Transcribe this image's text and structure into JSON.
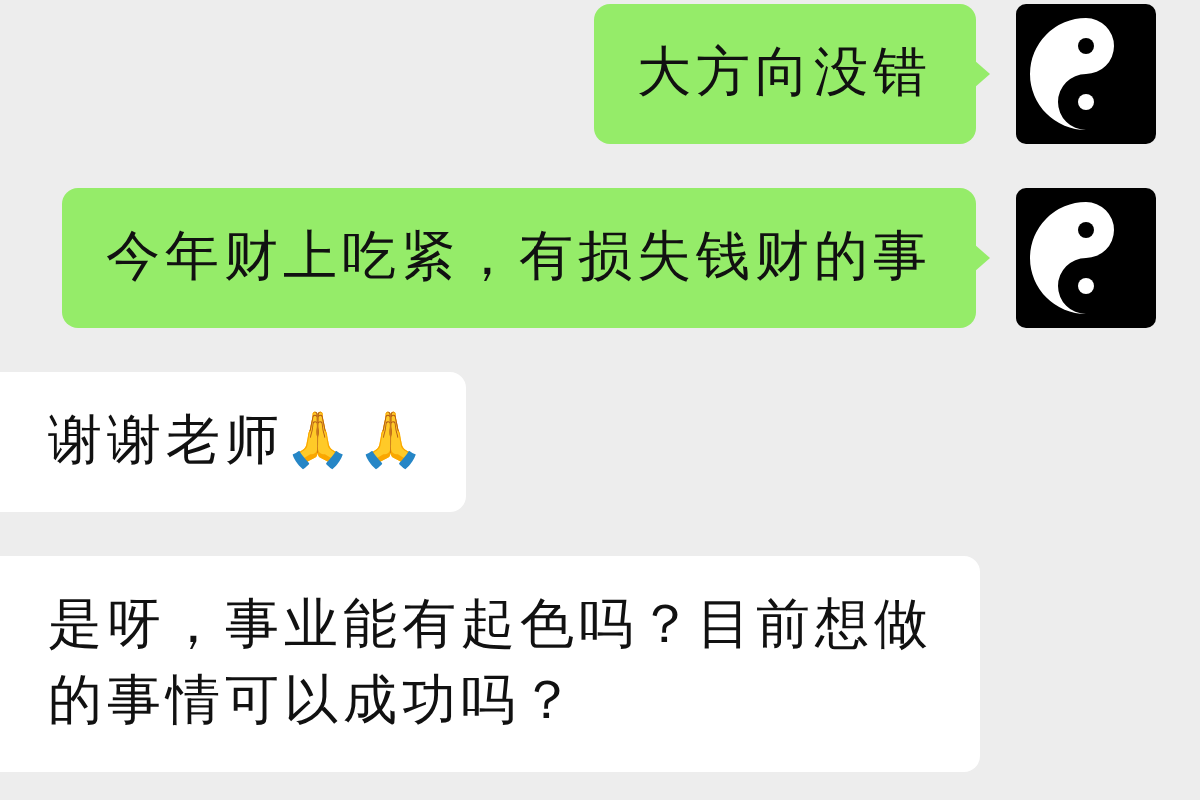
{
  "messages": [
    {
      "kind": "sent",
      "text": "大方向没错"
    },
    {
      "kind": "sent",
      "text": "今年财上吃紧，有损失钱财的事"
    },
    {
      "kind": "received",
      "text": "谢谢老师🙏🙏"
    },
    {
      "kind": "received",
      "text": "是呀，事业能有起色吗？目前想做的事情可以成功吗？"
    }
  ]
}
